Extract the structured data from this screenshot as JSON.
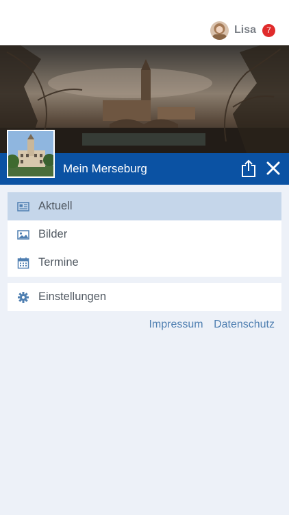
{
  "user": {
    "name": "Lisa",
    "notification_count": "7"
  },
  "header": {
    "title": "Mein Merseburg"
  },
  "menu": [
    {
      "label": "Aktuell",
      "icon": "newspaper-icon",
      "active": true
    },
    {
      "label": "Bilder",
      "icon": "image-icon",
      "active": false
    },
    {
      "label": "Termine",
      "icon": "calendar-icon",
      "active": false
    }
  ],
  "settings": {
    "label": "Einstellungen",
    "icon": "gear-icon"
  },
  "footer": {
    "impressum": "Impressum",
    "datenschutz": "Datenschutz"
  },
  "colors": {
    "primary": "#0b52a3",
    "active_item": "#c5d6ea",
    "background": "#edf1f8",
    "badge": "#e02b2b",
    "link": "#4f7fb1"
  }
}
